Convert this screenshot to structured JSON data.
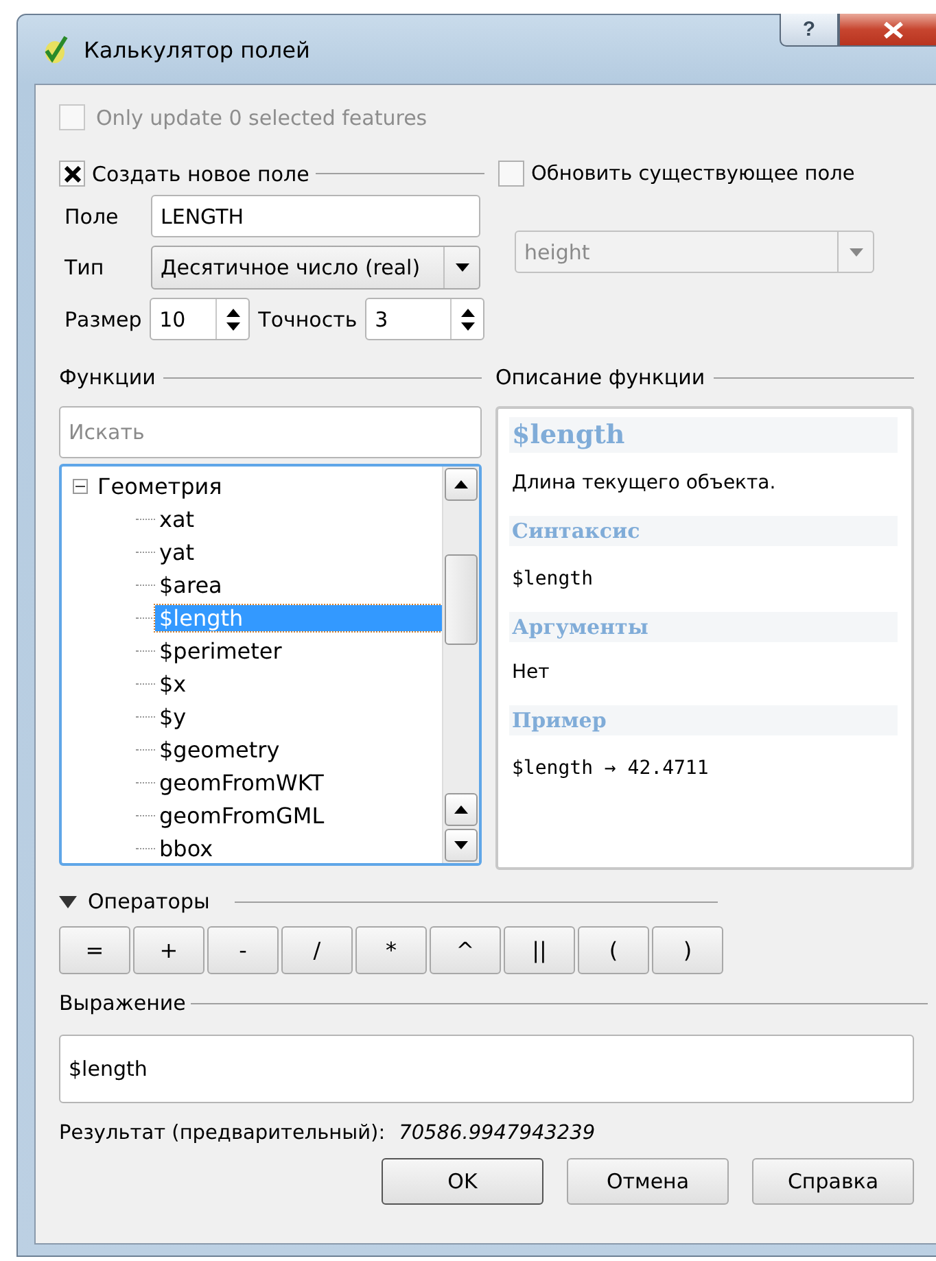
{
  "window": {
    "title": "Калькулятор полей",
    "help": "?"
  },
  "only_selected": {
    "label": "Only update 0 selected features",
    "checked": false,
    "disabled": true
  },
  "create_field": {
    "label": "Создать новое поле",
    "checked": true,
    "field_label": "Поле",
    "field_value": "LENGTH",
    "type_label": "Тип",
    "type_value": "Десятичное число (real)",
    "size_label": "Размер",
    "size_value": "10",
    "precision_label": "Точность",
    "precision_value": "3"
  },
  "update_field": {
    "label": "Обновить существующее поле",
    "checked": false,
    "value": "height"
  },
  "functions": {
    "title": "Функции",
    "search_placeholder": "Искать",
    "tree": [
      {
        "label": "Геометрия",
        "expanded": true,
        "children": [
          {
            "label": "xat",
            "selected": false
          },
          {
            "label": "yat",
            "selected": false
          },
          {
            "label": "$area",
            "selected": false
          },
          {
            "label": "$length",
            "selected": true
          },
          {
            "label": "$perimeter",
            "selected": false
          },
          {
            "label": "$x",
            "selected": false
          },
          {
            "label": "$y",
            "selected": false
          },
          {
            "label": "$geometry",
            "selected": false
          },
          {
            "label": "geomFromWKT",
            "selected": false
          },
          {
            "label": "geomFromGML",
            "selected": false
          },
          {
            "label": "bbox",
            "selected": false
          }
        ]
      }
    ]
  },
  "description": {
    "title": "Описание функции",
    "blocks": [
      {
        "kind": "heading",
        "text": "$length"
      },
      {
        "kind": "text",
        "text": "Длина текущего объекта."
      },
      {
        "kind": "subheading",
        "text": "Синтаксис"
      },
      {
        "kind": "code",
        "text": "$length"
      },
      {
        "kind": "subheading",
        "text": "Аргументы"
      },
      {
        "kind": "text",
        "text": "Нет"
      },
      {
        "kind": "subheading",
        "text": "Пример"
      },
      {
        "kind": "code",
        "text": "$length → 42.4711"
      }
    ]
  },
  "operators": {
    "title": "Операторы",
    "expanded": true,
    "buttons": [
      "=",
      "+",
      "-",
      "/",
      "*",
      "^",
      "||",
      "(",
      ")"
    ]
  },
  "expression": {
    "title": "Выражение",
    "value": "$length"
  },
  "result": {
    "label": "Результат (предварительный):",
    "value": "70586.9947943239"
  },
  "buttons": [
    "OK",
    "Отмена",
    "Справка"
  ]
}
